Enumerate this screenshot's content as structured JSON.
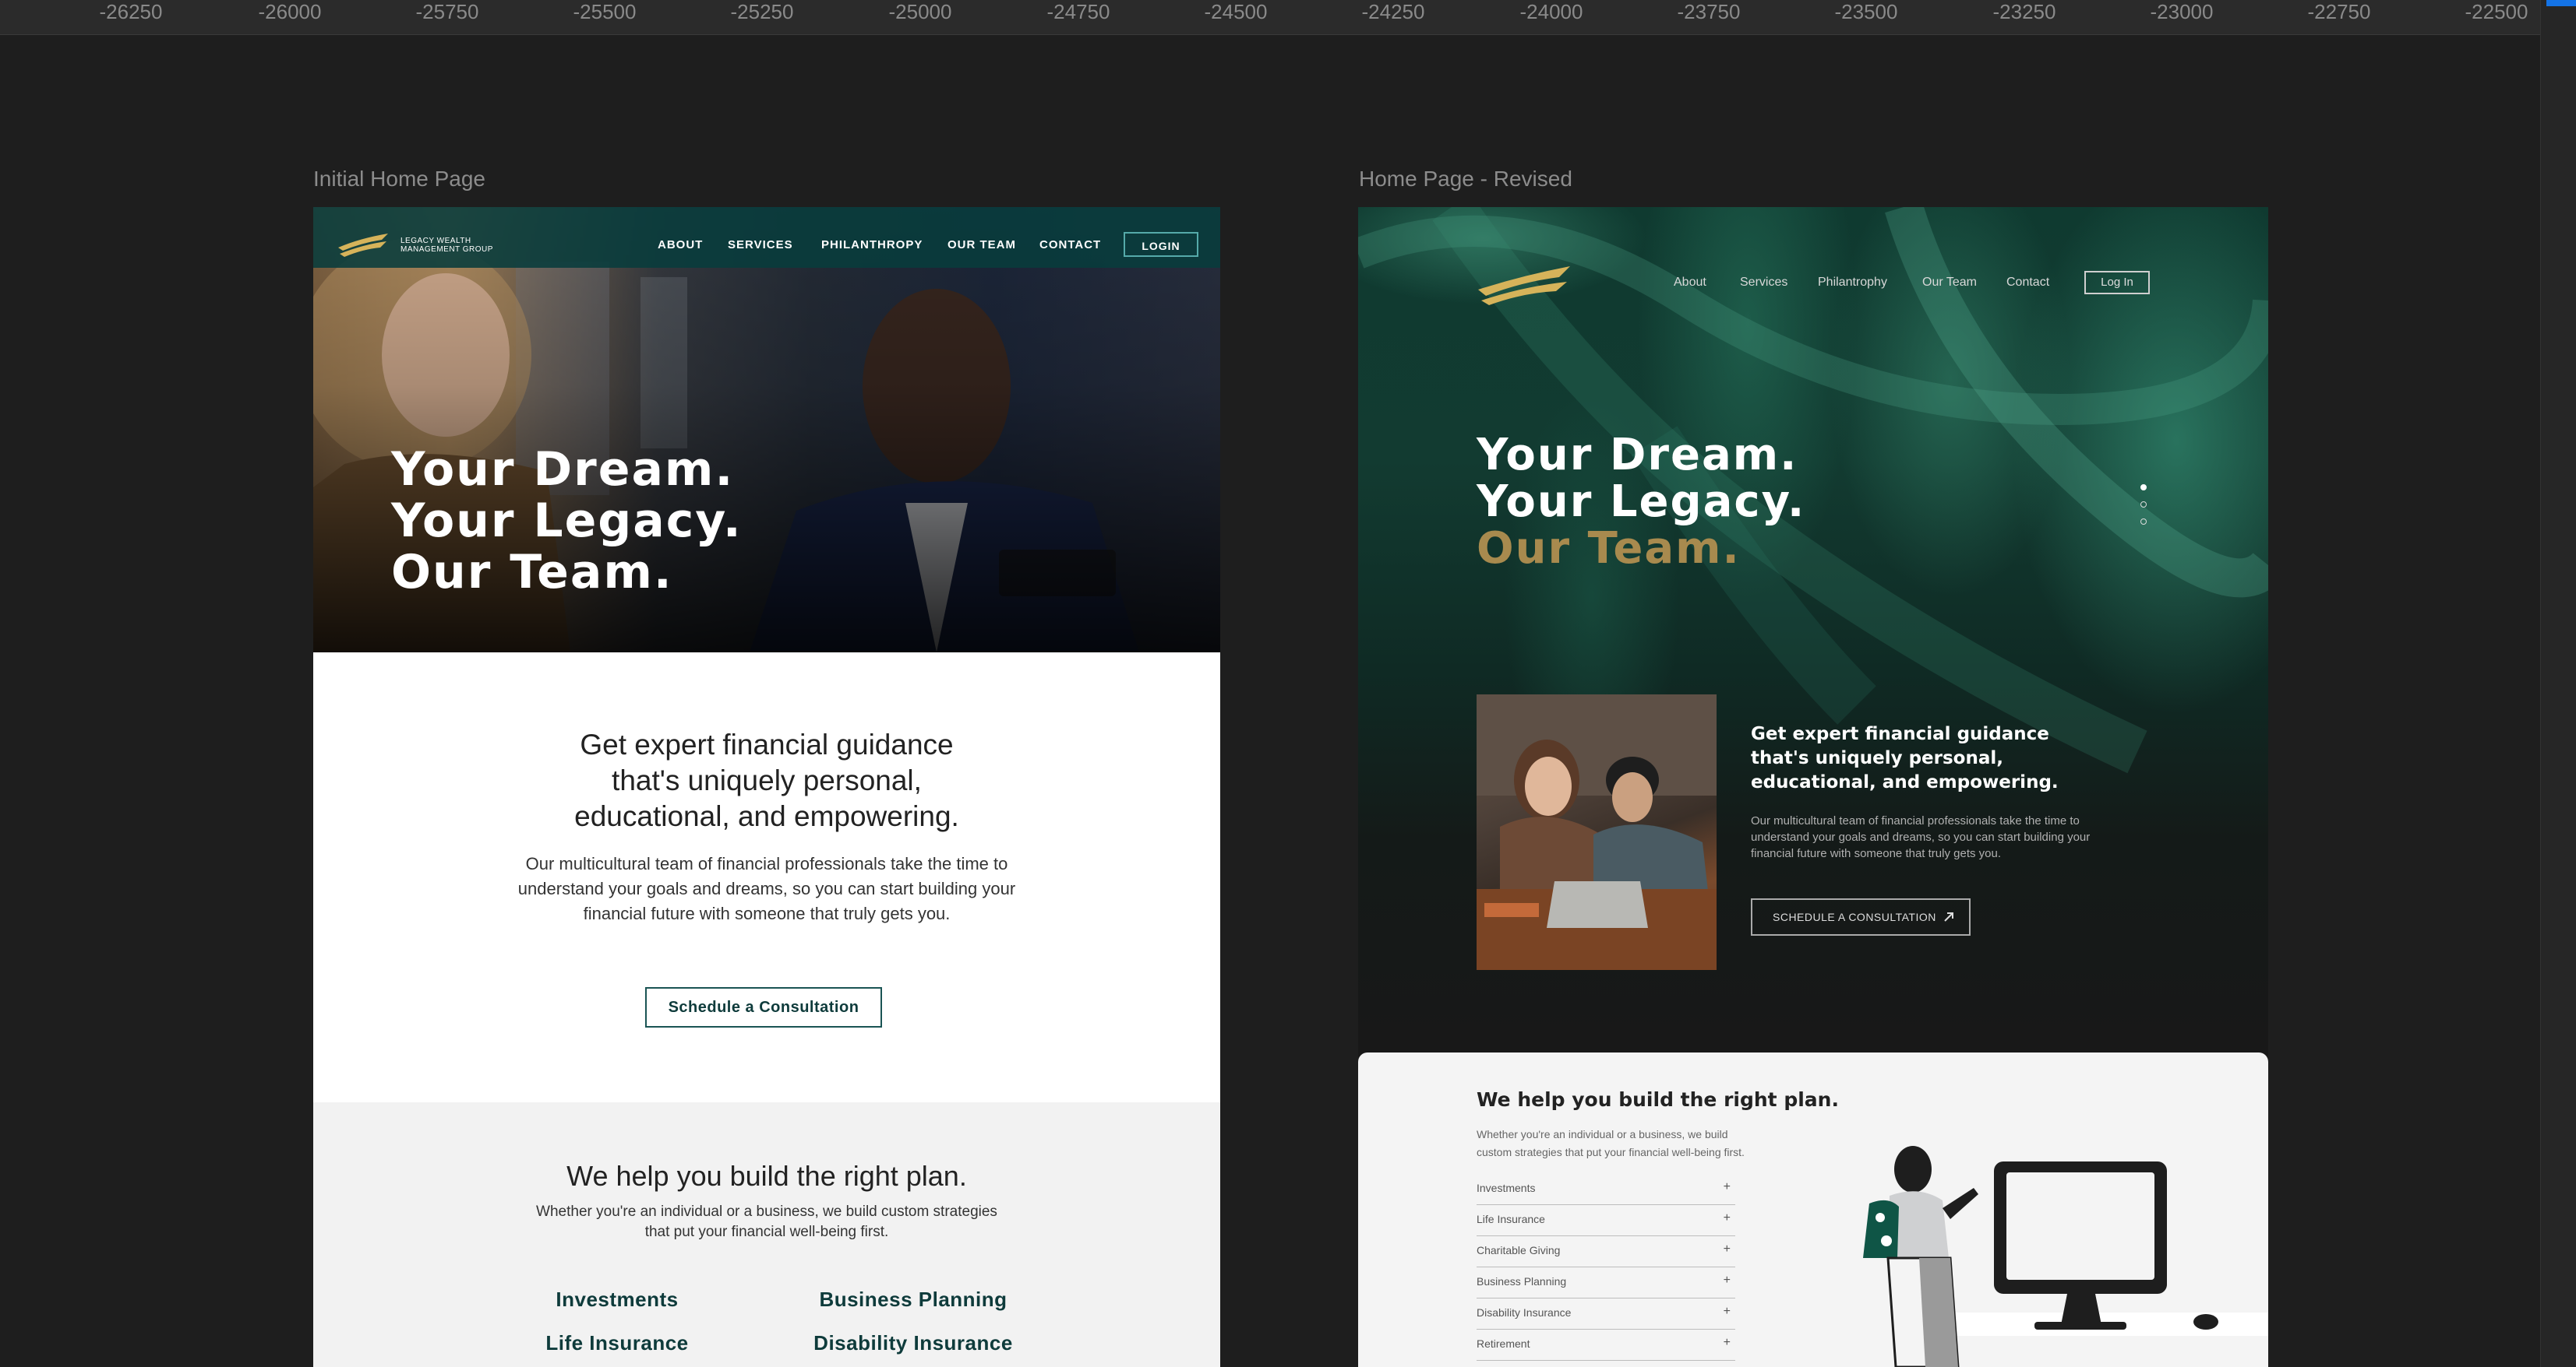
{
  "ruler": {
    "ticks": [
      "-26250",
      "-26000",
      "-25750",
      "-25500",
      "-25250",
      "-25000",
      "-24750",
      "-24500",
      "-24250",
      "-24000",
      "-23750",
      "-23500",
      "-23250",
      "-23000",
      "-22750",
      "-22500"
    ]
  },
  "frames": {
    "initial_label": "Initial Home Page",
    "revised_label": "Home Page - Revised"
  },
  "initial": {
    "logo_text_line1": "LEGACY WEALTH",
    "logo_text_line2": "MANAGEMENT GROUP",
    "nav": [
      "ABOUT",
      "SERVICES",
      "PHILANTHROPY",
      "OUR TEAM",
      "CONTACT"
    ],
    "login": "LOGIN",
    "hero_line1": "Your Dream.",
    "hero_line2": "Your Legacy.",
    "hero_line3": "Our Team.",
    "sub_line1": "Get expert financial guidance",
    "sub_line2": "that's uniquely personal,",
    "sub_line3": "educational, and empowering.",
    "body_line1": "Our multicultural team of financial professionals take the time to",
    "body_line2": "understand your goals and dreams, so you can start building your",
    "body_line3": "financial future with someone that truly gets you.",
    "cta": "Schedule a Consultation",
    "plan_title": "We help you build the right plan.",
    "plan_line1": "Whether you're an individual or a business, we build custom strategies",
    "plan_line2": "that put your financial well-being first.",
    "services": [
      "Investments",
      "Business Planning",
      "Life Insurance",
      "Disability Insurance"
    ]
  },
  "revised": {
    "nav": [
      "About",
      "Services",
      "Philantrophy",
      "Our Team",
      "Contact"
    ],
    "login": "Log In",
    "hero_line1": "Your Dream.",
    "hero_line2": "Your Legacy.",
    "hero_line3": "Our Team.",
    "accent_color": "#a88a4e",
    "sub_line1": "Get expert financial guidance",
    "sub_line2": "that's uniquely personal,",
    "sub_line3": "educational, and empowering.",
    "body_line1": "Our multicultural team of financial professionals take the time to",
    "body_line2": "understand your goals and dreams, so you can start building your",
    "body_line3": "financial future with someone that truly gets you.",
    "cta": "SCHEDULE A CONSULTATION",
    "plan_title": "We help you build the right plan.",
    "plan_line1": "Whether you're an individual or a business, we build",
    "plan_line2": "custom strategies that put your financial well-being first.",
    "services": [
      "Investments",
      "Life Insurance",
      "Charitable Giving",
      "Business Planning",
      "Disability Insurance",
      "Retirement"
    ]
  }
}
